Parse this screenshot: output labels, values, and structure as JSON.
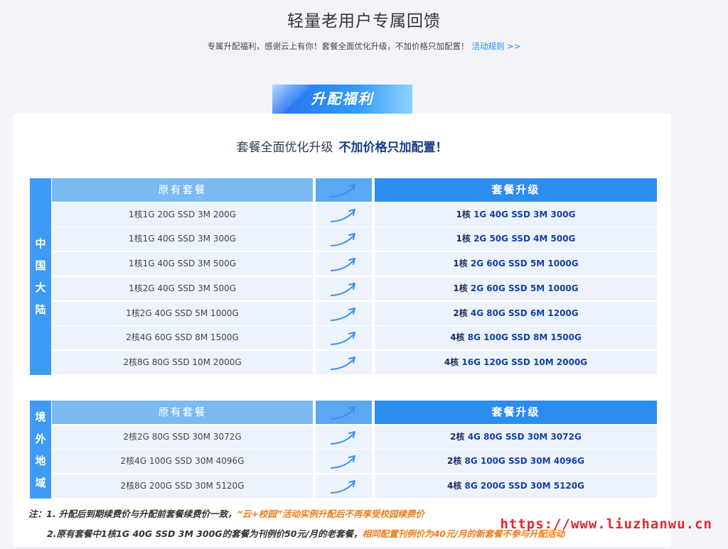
{
  "hero": {
    "title": "轻量老用户专属回馈",
    "subtitle": "专属升配福利，感谢云上有你！套餐全面优化升级，不加价格只加配置！",
    "rules_link": "活动规则 >>"
  },
  "banner": "升配福利",
  "headline": {
    "text": "套餐全面优化升级",
    "emphasis": "不加价格只加配置！"
  },
  "columns": {
    "original": "原有套餐",
    "upgrade": "套餐升级"
  },
  "regions": [
    {
      "label": [
        "中",
        "国",
        "大",
        "陆"
      ],
      "rows": [
        {
          "original": "1核1G 20G SSD 3M 200G",
          "upgrade": "1核 1G 40G SSD 3M 300G"
        },
        {
          "original": "1核1G 40G SSD 3M 300G",
          "upgrade": "1核 2G 50G SSD 4M 500G"
        },
        {
          "original": "1核1G 40G SSD 3M 500G",
          "upgrade": "1核 2G 60G SSD 5M 1000G"
        },
        {
          "original": "1核2G 40G SSD 3M 500G",
          "upgrade": "1核 2G 60G SSD 5M 1000G"
        },
        {
          "original": "1核2G 40G SSD 5M 1000G",
          "upgrade": "2核 4G 80G SSD 6M 1200G"
        },
        {
          "original": "2核4G 60G SSD 8M 1500G",
          "upgrade": "4核 8G 100G SSD 8M 1500G"
        },
        {
          "original": "2核8G 80G SSD 10M 2000G",
          "upgrade": "4核 16G 120G SSD 10M 2000G"
        }
      ]
    },
    {
      "label": [
        "境",
        "外",
        "地",
        "域"
      ],
      "rows": [
        {
          "original": "2核2G 80G SSD 30M 3072G",
          "upgrade": "2核 4G 80G SSD 30M 3072G"
        },
        {
          "original": "2核4G 100G SSD 30M 4096G",
          "upgrade": "2核 8G 100G SSD 30M 4096G"
        },
        {
          "original": "2核8G 200G SSD 30M 5120G",
          "upgrade": "4核 8G 200G SSD 30M 5120G"
        }
      ]
    }
  ],
  "notes": {
    "n1_a": "注：1. 升配后到期续费价与升配前套餐续费价一致，",
    "n1_b": "“云+校园”活动实例升配后不再享受校园续费价",
    "n2_a": "2.原有套餐中1核1G 40G SSD  3M 300G的套餐为刊例价50元/月的老套餐，",
    "n2_b": "相同配置刊例价为40元/月的新套餐不参与升配活动"
  },
  "watermark": "https://www.liuzhanwu.cn",
  "colors": {
    "accent": "#2c8df0",
    "region": "#3d9bf3",
    "header_left": "#7bb9f1",
    "note_orange": "#f07c1b",
    "watermark": "#e8262b"
  }
}
